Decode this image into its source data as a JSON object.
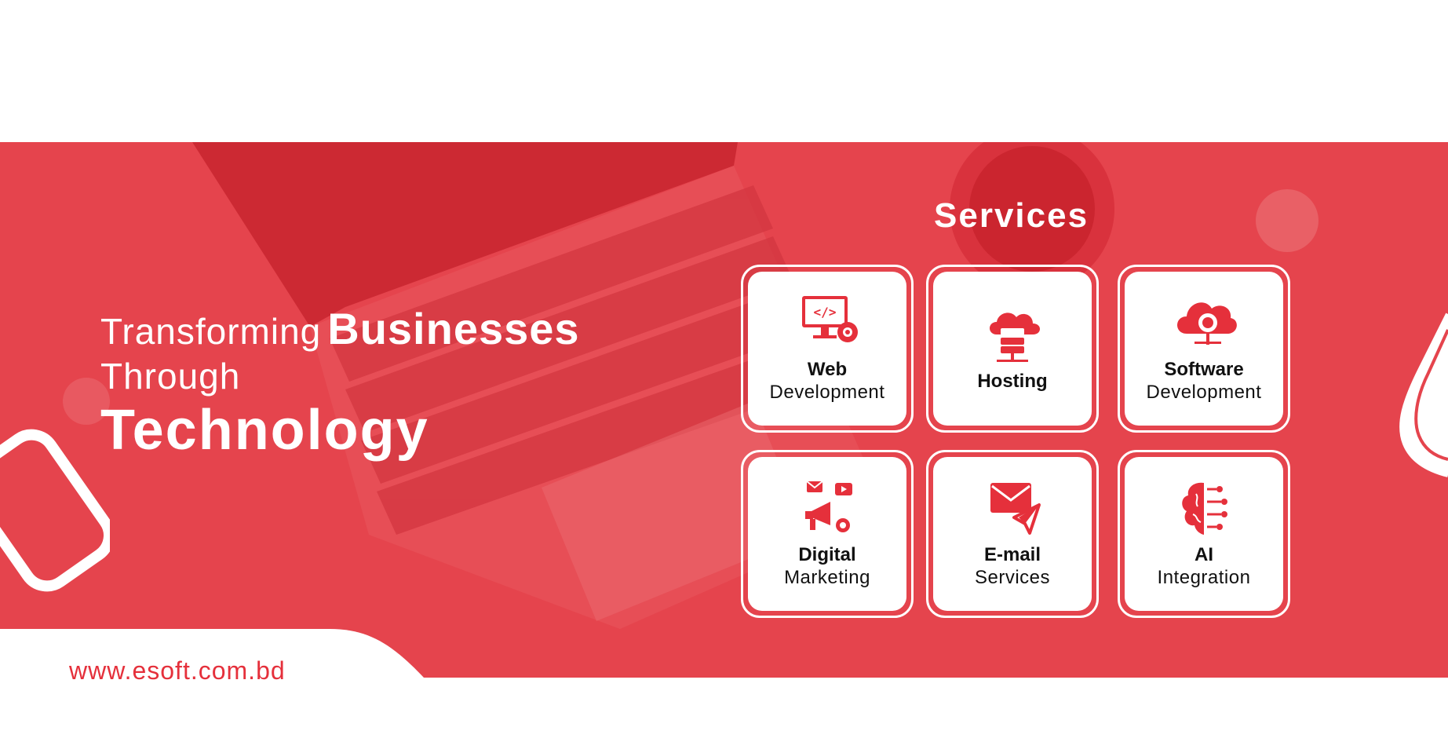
{
  "headline": {
    "line1_regular": "Transforming",
    "line1_bold": "Businesses",
    "line2": "Through",
    "line3": "Technology"
  },
  "services": {
    "title": "Services",
    "items": [
      {
        "title": "Web",
        "subtitle": "Development",
        "icon": "web-development-icon"
      },
      {
        "title": "Hosting",
        "subtitle": "",
        "icon": "cloud-hosting-icon"
      },
      {
        "title": "Software",
        "subtitle": "Development",
        "icon": "software-cloud-gear-icon"
      },
      {
        "title": "Digital",
        "subtitle": "Marketing",
        "icon": "megaphone-marketing-icon"
      },
      {
        "title": "E-mail",
        "subtitle": "Services",
        "icon": "email-send-icon"
      },
      {
        "title": "AI",
        "subtitle": "Integration",
        "icon": "ai-brain-icon"
      }
    ]
  },
  "footer": {
    "url": "www.esoft.com.bd"
  },
  "colors": {
    "brand_red": "#e5444d",
    "url_red": "#e5303b",
    "white": "#ffffff"
  }
}
